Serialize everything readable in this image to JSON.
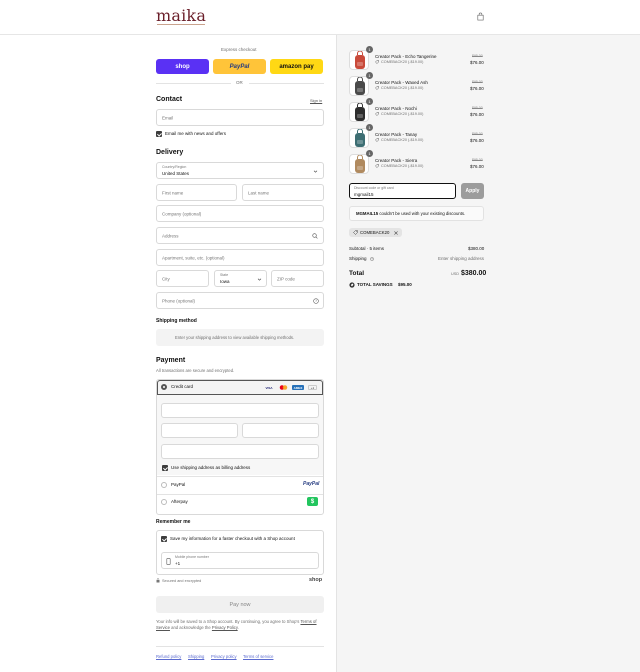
{
  "brand": {
    "name": "maika",
    "accent": "#6b1f2a"
  },
  "express": {
    "heading": "Express checkout",
    "shop_label": "shop",
    "paypal_label": "PayPal",
    "amazon_label": "amazon pay",
    "or_label": "OR",
    "colors": {
      "shop": "#5a31f4",
      "paypal": "#ffc439",
      "amazon": "#ffd814"
    }
  },
  "contact": {
    "title": "Contact",
    "signin_label": "Sign in",
    "email_placeholder": "Email",
    "news_label": "Email me with news and offers"
  },
  "delivery": {
    "title": "Delivery",
    "country_label": "Country/Region",
    "country_value": "United States",
    "first_name_placeholder": "First name",
    "last_name_placeholder": "Last name",
    "company_placeholder": "Company (optional)",
    "address_placeholder": "Address",
    "apartment_placeholder": "Apartment, suite, etc. (optional)",
    "city_placeholder": "City",
    "state_label": "State",
    "state_value": "Iowa",
    "zip_placeholder": "ZIP code",
    "phone_placeholder": "Phone (optional)"
  },
  "shipping": {
    "title": "Shipping method",
    "notice": "Enter your shipping address to view available shipping methods."
  },
  "payment": {
    "title": "Payment",
    "subtitle": "All transactions are secure and encrypted.",
    "credit_card_label": "Credit card",
    "card_brands": [
      "VISA",
      "MC",
      "AMEX",
      "+1"
    ],
    "billing_label": "Use shipping address as billing address",
    "paypal_label": "PayPal",
    "paypal_logo": "PayPal",
    "afterpay_label": "Afterpay",
    "afterpay_logo": "$"
  },
  "remember": {
    "title": "Remember me",
    "save_label": "Save my information for a faster checkout with a Shop account",
    "mobile_label": "Mobile phone number",
    "mobile_value": "+1",
    "secure_label": "Secured and encrypted",
    "shop_label": "shop"
  },
  "pay_now": {
    "label": "Pay now"
  },
  "legal": {
    "text_1": "Your info will be saved to a Shop account. By continuing, you agree to Shop's",
    "terms_link": "Terms of Service",
    "text_2": "and acknowledge the",
    "privacy_link": "Privacy Policy",
    "text_3": "."
  },
  "footer_links": [
    "Refund policy",
    "Shipping",
    "Privacy policy",
    "Terms of service"
  ],
  "order": {
    "items": [
      {
        "name": "Creator Pack - Echo Tangerine",
        "discount": "COMEBACK20 (-$19.00)",
        "orig": "$95.00",
        "price": "$76.00",
        "qty": "1",
        "color": "#c94a3a"
      },
      {
        "name": "Creator Pack - Waxed Ash",
        "discount": "COMEBACK20 (-$19.00)",
        "orig": "$95.00",
        "price": "$76.00",
        "qty": "1",
        "color": "#4a4a4a"
      },
      {
        "name": "Creator Pack - Nochi",
        "discount": "COMEBACK20 (-$19.00)",
        "orig": "$95.00",
        "price": "$76.00",
        "qty": "1",
        "color": "#2e2e2e"
      },
      {
        "name": "Creator Pack - Tanay",
        "discount": "COMEBACK20 (-$19.00)",
        "orig": "$95.00",
        "price": "$76.00",
        "qty": "1",
        "color": "#3d6e73"
      },
      {
        "name": "Creator Pack - Sierra",
        "discount": "COMEBACK20 (-$19.00)",
        "orig": "$95.00",
        "price": "$76.00",
        "qty": "1",
        "color": "#b08a5f"
      }
    ],
    "discount_label": "Discount code or gift card",
    "discount_value": "mgmail15",
    "apply_label": "Apply",
    "error_code": "MGMAIL15",
    "error_text": "couldn't be used with your existing discounts.",
    "applied_code": "COMEBACK20",
    "subtotal_label": "Subtotal · 5 items",
    "subtotal_value": "$380.00",
    "shipping_label": "Shipping",
    "shipping_value": "Enter shipping address",
    "total_label": "Total",
    "currency": "USD",
    "total_value": "$380.00",
    "savings_label": "TOTAL SAVINGS",
    "savings_value": "$95.00"
  }
}
